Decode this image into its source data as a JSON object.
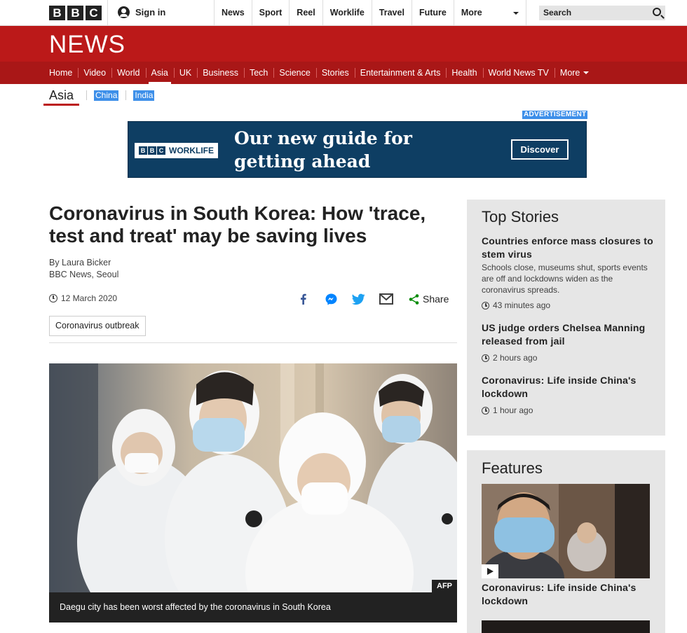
{
  "global_nav": {
    "logo_letters": [
      "B",
      "B",
      "C"
    ],
    "signin": "Sign in",
    "items": [
      "News",
      "Sport",
      "Reel",
      "Worklife",
      "Travel",
      "Future"
    ],
    "more": "More",
    "search_placeholder": "Search"
  },
  "news_banner": {
    "wordmark": "NEWS"
  },
  "news_nav": {
    "items": [
      "Home",
      "Video",
      "World",
      "Asia",
      "UK",
      "Business",
      "Tech",
      "Science",
      "Stories",
      "Entertainment & Arts",
      "Health",
      "World News TV",
      "More"
    ],
    "active": "Asia"
  },
  "sub_nav": {
    "current": "Asia",
    "items": [
      "China",
      "India"
    ]
  },
  "advert": {
    "label": "ADVERTISEMENT",
    "brand_letters": [
      "B",
      "B",
      "C"
    ],
    "brand": "WORKLIFE",
    "headline": "Our new guide for getting ahead",
    "cta": "Discover",
    "colors": {
      "background": "#0e3e63"
    }
  },
  "article": {
    "title": "Coronavirus in South Korea: How 'trace, test and treat' may be saving lives",
    "author": "By Laura Bicker",
    "location": "BBC News, Seoul",
    "date": "12 March 2020",
    "share_label": "Share",
    "share_icons": [
      "facebook-icon",
      "messenger-icon",
      "twitter-icon",
      "email-icon",
      "share-icon"
    ],
    "tag": "Coronavirus outbreak",
    "image_credit": "AFP",
    "image_caption": "Daegu city has been worst affected by the coronavirus in South Korea"
  },
  "top_stories": {
    "heading": "Top Stories",
    "items": [
      {
        "title": "Countries enforce mass closures to stem virus",
        "summary": "Schools close, museums shut, sports events are off and lockdowns widen as the coronavirus spreads.",
        "ago": "43 minutes ago"
      },
      {
        "title": "US judge orders Chelsea Manning released from jail",
        "summary": "",
        "ago": "2 hours ago"
      },
      {
        "title": "Coronavirus: Life inside China's lockdown",
        "summary": "",
        "ago": "1 hour ago"
      }
    ]
  },
  "features": {
    "heading": "Features",
    "items": [
      {
        "title": "Coronavirus: Life inside China's lockdown"
      }
    ]
  },
  "colors": {
    "brand_red": "#bb1919",
    "nav_red": "#a91717",
    "chip_blue": "#3d8fe9"
  }
}
